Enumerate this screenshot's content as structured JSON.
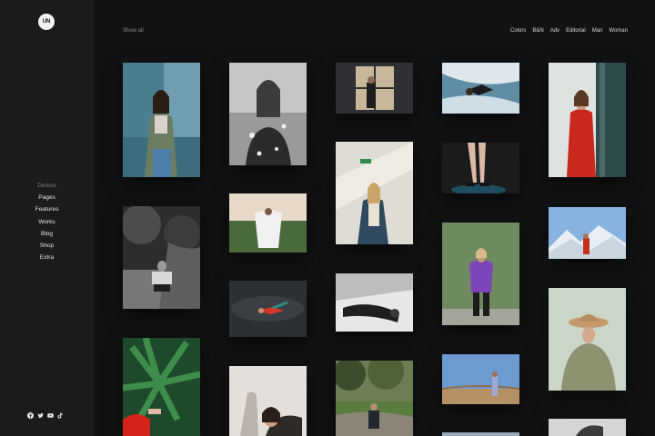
{
  "logo": {
    "text": "UN"
  },
  "sidebar": {
    "items": [
      {
        "label": "Demos",
        "muted": true
      },
      {
        "label": "Pages"
      },
      {
        "label": "Features"
      },
      {
        "label": "Works"
      },
      {
        "label": "Blog"
      },
      {
        "label": "Shop"
      },
      {
        "label": "Extra"
      }
    ],
    "socials": [
      "facebook-icon",
      "twitter-icon",
      "youtube-icon",
      "tiktok-icon"
    ]
  },
  "toolbar": {
    "show_all": "Show all",
    "filters": [
      "Colors",
      "B&N",
      "Adv",
      "Editorial",
      "Man",
      "Woman"
    ]
  },
  "colors": {
    "background": "#111213",
    "sidebar": "#1a1b1c",
    "text": "#e6e6e6",
    "muted": "#7d7d7d"
  }
}
